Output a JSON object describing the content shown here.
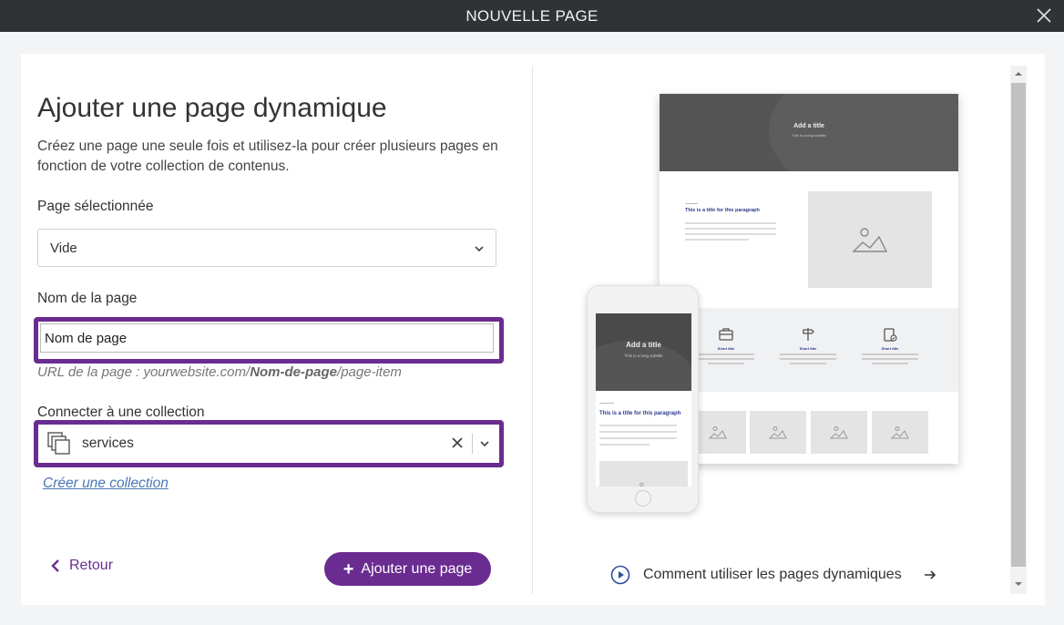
{
  "window": {
    "title": "NOUVELLE PAGE"
  },
  "form": {
    "heading": "Ajouter une page dynamique",
    "description": "Créez une page une seule fois et utilisez-la pour créer plusieurs pages en fonction de votre collection de contenus.",
    "selected_page_label": "Page sélectionnée",
    "selected_page_value": "Vide",
    "page_name_label": "Nom de la page",
    "page_name_value": "Nom de page",
    "url_prefix": "URL de la page : yourwebsite.com/",
    "url_bold": "Nom-de-page",
    "url_suffix": "/page-item",
    "collection_label": "Connecter à une collection",
    "collection_value": "services",
    "create_collection_link": "Créer une collection"
  },
  "actions": {
    "back_label": "Retour",
    "add_label": "Ajouter une page"
  },
  "preview": {
    "desktop_hero_title": "Add a title",
    "desktop_hero_subtitle": "This is a long subtitle",
    "desktop_paragraph_title": "This is a title for this paragraph",
    "features": [
      "Short title",
      "Short title",
      "Short title"
    ],
    "mobile_hero_title": "Add a title",
    "mobile_hero_subtitle": "This is a long subtitle",
    "mobile_paragraph_title": "This is a title for this paragraph"
  },
  "help": {
    "label": "Comment utiliser les pages dynamiques"
  },
  "colors": {
    "accent": "#6a2c91",
    "link": "#4a77b3",
    "titlebar": "#2f3336"
  }
}
